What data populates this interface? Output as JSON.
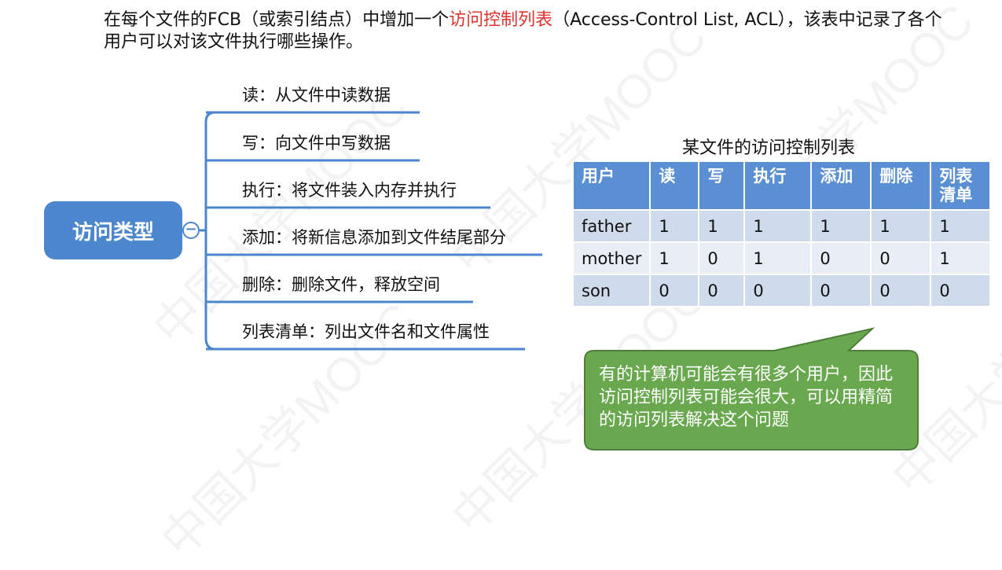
{
  "intro": {
    "before": "在每个文件的FCB（或索引结点）中增加一个",
    "highlight": "访问控制列表",
    "after": "（Access-Control List, ACL），该表中记录了各个用户可以对该文件执行哪些操作。",
    "highlight_color": "#e0322e"
  },
  "watermark": "中国大学MOOC",
  "mindmap": {
    "center": "访问类型",
    "collapse_symbol": "−",
    "branches": [
      {
        "label": "读：从文件中读数据"
      },
      {
        "label": "写：向文件中写数据"
      },
      {
        "label": "执行：将文件装入内存并执行"
      },
      {
        "label": "添加：将新信息添加到文件结尾部分"
      },
      {
        "label": "删除：删除文件，释放空间"
      },
      {
        "label": "列表清单：列出文件名和文件属性"
      }
    ],
    "color": "#4c86cc"
  },
  "acl_table": {
    "title": "某文件的访问控制列表",
    "headers": [
      "用户",
      "读",
      "写",
      "执行",
      "添加",
      "删除",
      "列表清单"
    ],
    "rows": [
      [
        "father",
        "1",
        "1",
        "1",
        "1",
        "1",
        "1"
      ],
      [
        "mother",
        "1",
        "0",
        "1",
        "0",
        "0",
        "1"
      ],
      [
        "son",
        "0",
        "0",
        "0",
        "0",
        "0",
        "0"
      ]
    ],
    "header_color": "#5b8fd3"
  },
  "callout": {
    "text": "有的计算机可能会有很多个用户，因此访问控制列表可能会很大，可以用精简的访问列表解决这个问题",
    "color": "#6aa84f"
  }
}
